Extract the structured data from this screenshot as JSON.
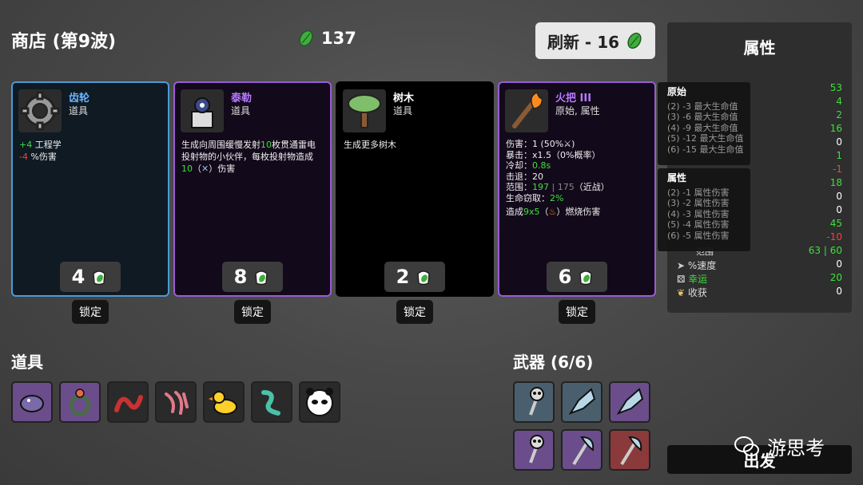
{
  "shop": {
    "title": "商店 (第9波)",
    "materials": "137",
    "reroll_label": "刷新 - 16"
  },
  "cards": [
    {
      "name": "齿轮",
      "type": "道具",
      "name_color": "#6ab4ff",
      "desc": [
        {
          "g": "+4",
          "t": " 工程学"
        },
        {
          "r": "-4",
          "t": " %伤害"
        }
      ],
      "price": "4",
      "lock": "锁定",
      "icon": "gear-icon"
    },
    {
      "name": "泰勒",
      "type": "道具",
      "name_color": "#b77bff",
      "desc_text_a": "生成向周围缓慢发射",
      "desc_num_a": "10",
      "desc_text_b": "枚贯通雷电投射物的小伙伴，每枚投射物造成",
      "desc_num_b": "10",
      "desc_text_c": "（",
      "desc_text_d": "）伤害",
      "price": "8",
      "lock": "锁定",
      "icon": "tyler-icon"
    },
    {
      "name": "树木",
      "type": "道具",
      "name_color": "#ffffff",
      "desc_text": "生成更多树木",
      "price": "2",
      "lock": "锁定",
      "icon": "tree-icon"
    },
    {
      "name": "火把 III",
      "type": "原始, 属性",
      "name_color": "#b77bff",
      "lines": {
        "dmg_a": "伤害：1 (50%",
        "dmg_b": ")",
        "crit": "暴击：x1.5（0%概率）",
        "cd_a": "冷却：",
        "cd_v": "0.8s",
        "kb": "击退：20",
        "range_a": "范围：",
        "range_v": "197",
        "range_sep": " | ",
        "range_old": "175",
        "range_c": "（近战）",
        "ls_a": "生命窃取：",
        "ls_v": "2%",
        "burn_a": "造成",
        "burn_v": "9x5",
        "burn_b": "（",
        "burn_c": "）燃烧伤害"
      },
      "price": "6",
      "lock": "锁定",
      "icon": "torch-icon"
    }
  ],
  "stats": {
    "title": "属性",
    "values": [
      {
        "v": "53",
        "color": "#3ce13c"
      },
      {
        "v": "4",
        "color": "#3ce13c"
      },
      {
        "v": "2",
        "color": "#3ce13c"
      },
      {
        "v": "16",
        "color": "#3ce13c"
      },
      {
        "v": "0",
        "color": "#ffffff"
      },
      {
        "v": "1",
        "color": "#3ce13c"
      },
      {
        "v": "-1",
        "color": "#ff3c3c"
      },
      {
        "v": "18",
        "color": "#3ce13c"
      },
      {
        "v": "0",
        "color": "#ffffff"
      },
      {
        "v": "0",
        "color": "#ffffff"
      },
      {
        "v": "45",
        "color": "#3ce13c"
      },
      {
        "v": "-10",
        "color": "#ff3c3c"
      }
    ],
    "range_value": "63 | 60",
    "rows": [
      {
        "label": "%速度",
        "v": "0",
        "color": "#ffffff",
        "icon": "speed-icon"
      },
      {
        "label": "幸运",
        "v": "20",
        "color": "#3ce13c",
        "icon": "dice-icon"
      },
      {
        "label": "收获",
        "v": "0",
        "color": "#ffffff",
        "icon": "harvest-icon"
      }
    ],
    "partial_label": "范围"
  },
  "popup_primitive": {
    "title": "原始",
    "lines": [
      "(2) -3 最大生命值",
      "(3) -6 最大生命值",
      "(4) -9 最大生命值",
      "(5) -12 最大生命值",
      "(6) -15 最大生命值"
    ]
  },
  "popup_elemental": {
    "title": "属性",
    "lines": [
      "(2) -1 属性伤害",
      "(3) -2 属性伤害",
      "(4) -3 属性伤害",
      "(5) -4 属性伤害",
      "(6) -5 属性伤害"
    ]
  },
  "items": {
    "title": "道具"
  },
  "weapons": {
    "title": "武器 (6/6)"
  },
  "go_label": "出发",
  "watermark": "游思考"
}
